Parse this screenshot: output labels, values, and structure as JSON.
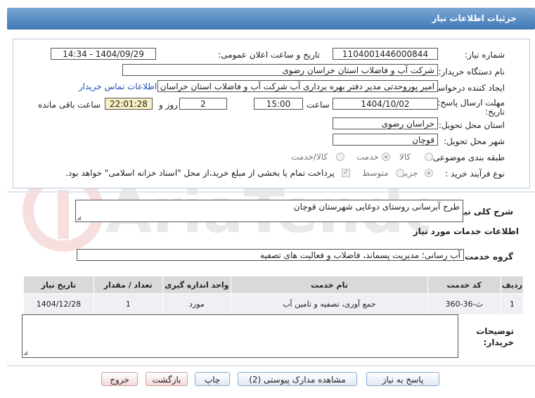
{
  "header": {
    "title": "جزئیات اطلاعات نیاز"
  },
  "form": {
    "need_number_label": "شماره نیاز:",
    "need_number": "1104001446000844",
    "announce_label": "تاریخ و ساعت اعلان عمومی:",
    "announce_value": "1404/09/29 - 14:34",
    "buyer_org_label": "نام دستگاه خریدار:",
    "buyer_org": "شرکت آب و فاضلاب استان خراسان رضوی",
    "creator_label": "ایجاد کننده درخواست:",
    "creator": "امیر پوروحدتی مدیر دفتر بهره برداری آب شرکت آب و فاضلاب استان خراسان رضوی",
    "contact_link": "اطلاعات تماس خریدار",
    "deadline_label_1": "مهلت ارسال پاسخ: تا",
    "deadline_label_2": "تاریخ:",
    "deadline_date": "1404/10/02",
    "hour_label": "ساعت",
    "deadline_time": "15:00",
    "days_value": "2",
    "days_label": "روز و",
    "remaining_time": "22:01:28",
    "remaining_label": "ساعت باقی مانده",
    "province_label": "استان محل تحویل:",
    "province": "خراسان رضوی",
    "city_label": "شهر محل تحویل:",
    "city": "قوچان",
    "category_label": "طبقه بندی موضوعی:",
    "category_options": [
      "کالا",
      "خدمت",
      "کالا/خدمت"
    ],
    "category_selected": "خدمت",
    "process_label": "نوع فرآیند خرید :",
    "process_options": [
      "جزیی",
      "متوسط"
    ],
    "process_selected": "جزیی",
    "payment_note": "پرداخت تمام یا بخشی از مبلغ خرید،از محل \"اسناد خزانه اسلامی\" خواهد بود."
  },
  "summary": {
    "label": "شرح کلی نیاز:",
    "value": "طرح آبرسانی روستای دوغایی شهرستان قوچان"
  },
  "services": {
    "section_title": "اطلاعات خدمات مورد نیاز",
    "group_label": "گروه خدمت:",
    "group_value": "آب رسانی؛ مدیریت پسماند، فاضلاب و فعالیت های تصفیه",
    "table": {
      "headers": [
        "ردیف",
        "کد خدمت",
        "نام خدمت",
        "واحد اندازه گیری",
        "تعداد / مقدار",
        "تاریخ نیاز"
      ],
      "rows": [
        {
          "row": "1",
          "code": "ث-36-360",
          "name": "جمع آوری، تصفیه و تامین آب",
          "unit": "مورد",
          "qty": "1",
          "date": "1404/12/28"
        }
      ]
    }
  },
  "notes": {
    "label_1": "توضیحات",
    "label_2": "خریدار:",
    "value": ""
  },
  "buttons": {
    "reply": "پاسخ به نیاز",
    "attachments": "مشاهده مدارک پیوستی (2)",
    "print": "چاپ",
    "back": "بازگشت",
    "exit": "خروج"
  },
  "watermark_text": "AriaTender.net"
}
